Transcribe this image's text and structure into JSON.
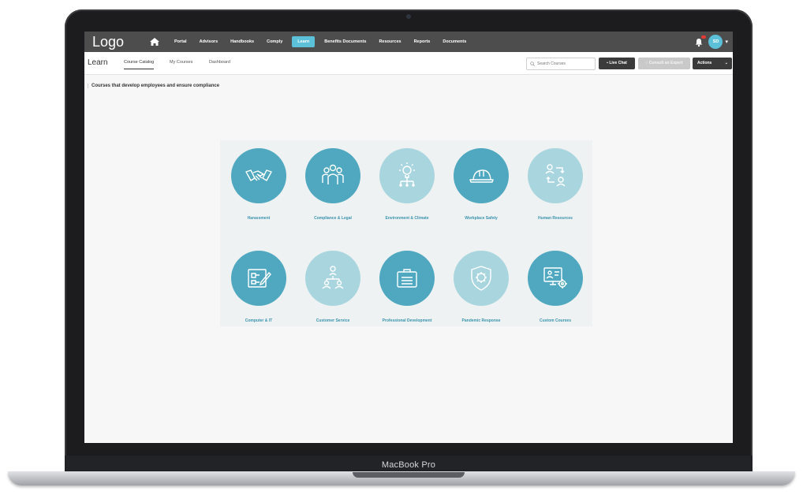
{
  "window": {
    "device_label": "MacBook Pro"
  },
  "nav": {
    "logo": "Logo",
    "items": [
      {
        "label": "Portal"
      },
      {
        "label": "Advisors"
      },
      {
        "label": "Handbooks"
      },
      {
        "label": "Comply"
      },
      {
        "label": "Learn"
      },
      {
        "label": "Benefits Documents"
      },
      {
        "label": "Resources"
      },
      {
        "label": "Reports"
      },
      {
        "label": "Documents"
      }
    ],
    "active": "Learn",
    "avatar_initials": "SD"
  },
  "subheader": {
    "title": "Learn",
    "tabs": [
      {
        "label": "Course Catalog"
      },
      {
        "label": "My Courses"
      },
      {
        "label": "Dashboard"
      }
    ],
    "active_tab": "Course Catalog",
    "search": {
      "placeholder": "Search Courses"
    },
    "buttons": {
      "live_chat": "Live Chat",
      "consult": "Consult an Expert",
      "actions": "Actions"
    }
  },
  "content": {
    "tagline": "Courses that develop employees and ensure compliance",
    "courses": [
      {
        "label": "Harassment",
        "icon": "handshake-icon",
        "tone": "dark"
      },
      {
        "label": "Compliance & Legal",
        "icon": "team-icon",
        "tone": "dark"
      },
      {
        "label": "Environment & Climate",
        "icon": "lightbulb-icon",
        "tone": "light"
      },
      {
        "label": "Workplace Safety",
        "icon": "hardhat-icon",
        "tone": "dark"
      },
      {
        "label": "Human Resources",
        "icon": "people-exchange-icon",
        "tone": "light"
      },
      {
        "label": "Computer & IT",
        "icon": "flowchart-edit-icon",
        "tone": "dark"
      },
      {
        "label": "Customer Service",
        "icon": "org-chart-icon",
        "tone": "light"
      },
      {
        "label": "Professional Development",
        "icon": "briefcase-icon",
        "tone": "dark"
      },
      {
        "label": "Pandemic Response",
        "icon": "virus-shield-icon",
        "tone": "light"
      },
      {
        "label": "Custom Courses",
        "icon": "monitor-gear-icon",
        "tone": "dark"
      }
    ]
  },
  "colors": {
    "accent": "#5cc0d9",
    "circle_dark": "#4fa8bf",
    "circle_light": "#a9d5df",
    "label": "#3a93ad",
    "nav_bg": "#4d4d4d"
  }
}
